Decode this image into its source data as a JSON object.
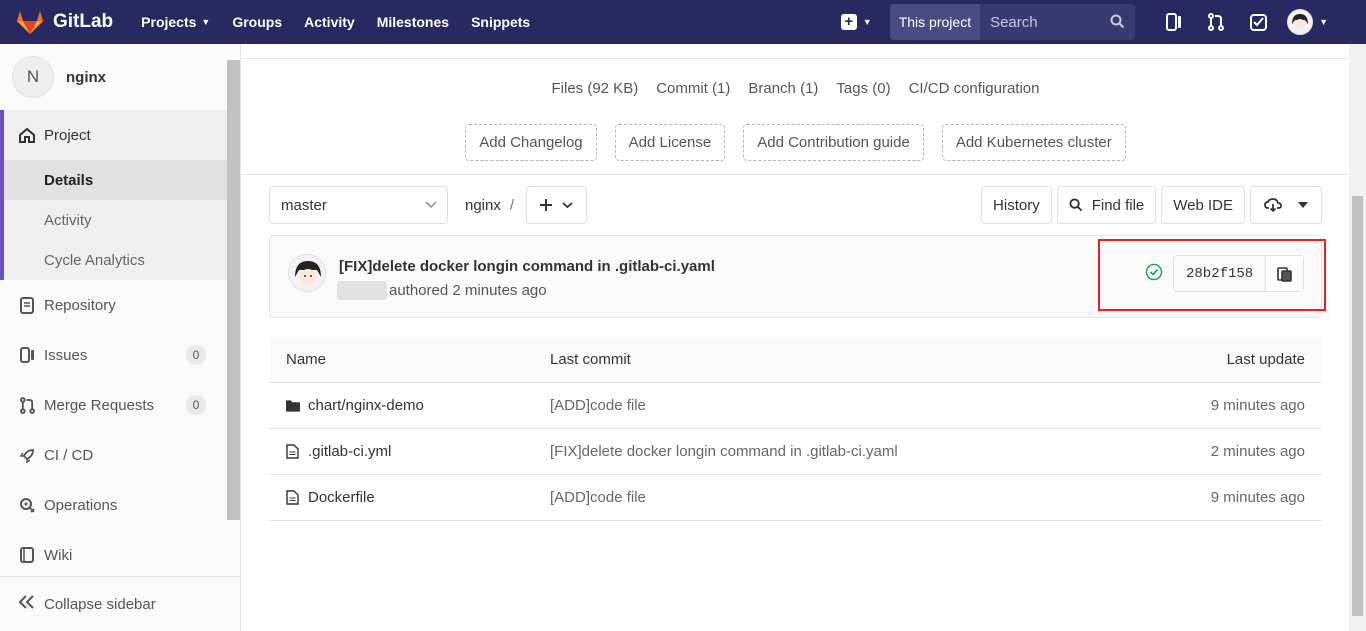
{
  "navbar": {
    "brand": "GitLab",
    "links": [
      {
        "label": "Projects",
        "has_caret": true
      },
      {
        "label": "Groups"
      },
      {
        "label": "Activity"
      },
      {
        "label": "Milestones"
      },
      {
        "label": "Snippets"
      }
    ],
    "search_scope": "This project",
    "search_placeholder": "Search",
    "colors": {
      "bg": "#292961",
      "scope_bg": "#4b4b83"
    }
  },
  "sidebar": {
    "project_initial": "N",
    "project_name": "nginx",
    "project_section": {
      "label": "Project",
      "items": [
        {
          "label": "Details",
          "active": true
        },
        {
          "label": "Activity"
        },
        {
          "label": "Cycle Analytics"
        }
      ]
    },
    "items": [
      {
        "label": "Repository",
        "icon": "repository-icon"
      },
      {
        "label": "Issues",
        "icon": "issues-icon",
        "count": "0"
      },
      {
        "label": "Merge Requests",
        "icon": "merge-request-icon",
        "count": "0"
      },
      {
        "label": "CI / CD",
        "icon": "rocket-icon"
      },
      {
        "label": "Operations",
        "icon": "operations-icon"
      },
      {
        "label": "Wiki",
        "icon": "wiki-icon"
      }
    ],
    "collapse_label": "Collapse sidebar"
  },
  "stats": [
    "Files (92 KB)",
    "Commit (1)",
    "Branch (1)",
    "Tags (0)",
    "CI/CD configuration"
  ],
  "add_buttons": [
    "Add Changelog",
    "Add License",
    "Add Contribution guide",
    "Add Kubernetes cluster"
  ],
  "toolbar": {
    "branch": "master",
    "path_root": "nginx",
    "path_sep": "/",
    "history": "History",
    "find_file": "Find file",
    "web_ide": "Web IDE"
  },
  "commit": {
    "title": "[FIX]delete docker longin command in .gitlab-ci.yaml",
    "meta": "authored 2 minutes ago",
    "sha": "28b2f158",
    "status": "passed",
    "highlight_color": "#e8231f"
  },
  "table": {
    "headers": {
      "name": "Name",
      "commit": "Last commit",
      "update": "Last update"
    },
    "rows": [
      {
        "type": "folder",
        "name": "chart/nginx-demo",
        "commit": "[ADD]code file",
        "update": "9 minutes ago"
      },
      {
        "type": "file",
        "name": ".gitlab-ci.yml",
        "commit": "[FIX]delete docker longin command in .gitlab-ci.yaml",
        "update": "2 minutes ago"
      },
      {
        "type": "file",
        "name": "Dockerfile",
        "commit": "[ADD]code file",
        "update": "9 minutes ago"
      }
    ]
  }
}
